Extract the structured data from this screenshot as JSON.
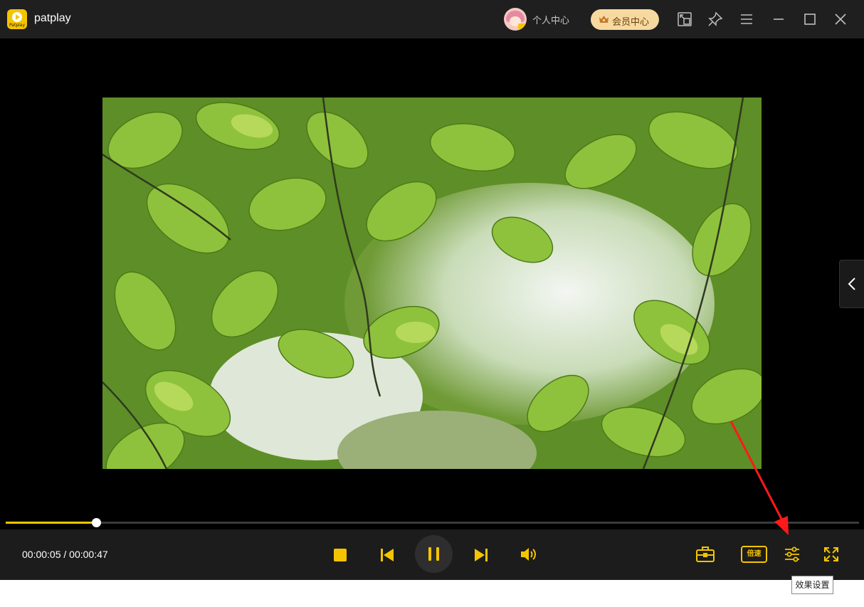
{
  "app": {
    "name": "patplay",
    "logo_text": "Patplay"
  },
  "titlebar": {
    "user_center_label": "个人中心",
    "vip_label": "会员中心",
    "buttons": [
      "mini-mode-icon",
      "pin-icon",
      "menu-icon",
      "minimize-icon",
      "maximize-icon",
      "close-icon"
    ]
  },
  "player": {
    "current_time": "00:00:05",
    "total_time": "00:00:47",
    "time_display": "00:00:05 / 00:00:47",
    "progress": 0.106,
    "speed_label": "倍速",
    "tooltip": "效果设置",
    "state": "playing"
  },
  "colors": {
    "accent": "#f5c400",
    "titlebar_bg": "#1f1f1f",
    "controlbar_bg": "#1c1c1c",
    "annotation_arrow": "#ff1a1a"
  }
}
